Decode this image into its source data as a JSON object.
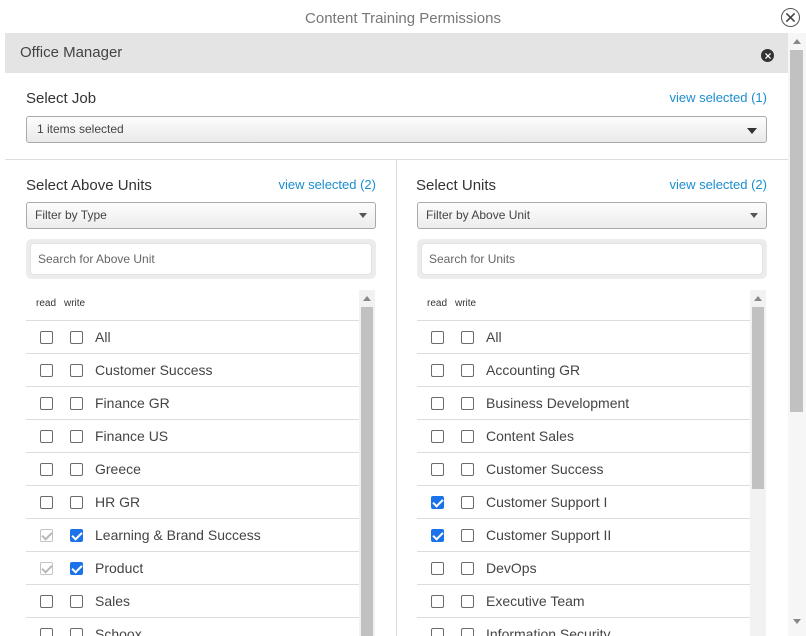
{
  "dialog": {
    "title": "Content Training Permissions"
  },
  "panel": {
    "title": "Office Manager"
  },
  "job": {
    "label": "Select Job",
    "view_selected": "view selected (1)",
    "select_value": "1 items selected"
  },
  "above_units": {
    "label": "Select Above Units",
    "view_selected": "view selected (2)",
    "filter_value": "Filter by Type",
    "search_placeholder": "Search for Above Unit",
    "col_read": "read",
    "col_write": "write",
    "items": [
      {
        "label": "All",
        "read": false,
        "write": false,
        "read_disabled": false
      },
      {
        "label": "Customer Success",
        "read": false,
        "write": false,
        "read_disabled": false
      },
      {
        "label": "Finance GR",
        "read": false,
        "write": false,
        "read_disabled": false
      },
      {
        "label": "Finance US",
        "read": false,
        "write": false,
        "read_disabled": false
      },
      {
        "label": "Greece",
        "read": false,
        "write": false,
        "read_disabled": false
      },
      {
        "label": "HR GR",
        "read": false,
        "write": false,
        "read_disabled": false
      },
      {
        "label": "Learning & Brand Success",
        "read": true,
        "write": true,
        "read_disabled": true
      },
      {
        "label": "Product",
        "read": true,
        "write": true,
        "read_disabled": true
      },
      {
        "label": "Sales",
        "read": false,
        "write": false,
        "read_disabled": false
      },
      {
        "label": "Schoox",
        "read": false,
        "write": false,
        "read_disabled": false
      }
    ]
  },
  "units": {
    "label": "Select Units",
    "view_selected": "view selected (2)",
    "filter_value": "Filter by Above Unit",
    "search_placeholder": "Search for Units",
    "col_read": "read",
    "col_write": "write",
    "items": [
      {
        "label": "All",
        "read": false,
        "write": false,
        "read_disabled": false
      },
      {
        "label": "Accounting GR",
        "read": false,
        "write": false,
        "read_disabled": false
      },
      {
        "label": "Business Development",
        "read": false,
        "write": false,
        "read_disabled": false
      },
      {
        "label": "Content Sales",
        "read": false,
        "write": false,
        "read_disabled": false
      },
      {
        "label": "Customer Success",
        "read": false,
        "write": false,
        "read_disabled": false
      },
      {
        "label": "Customer Support I",
        "read": true,
        "write": false,
        "read_disabled": false
      },
      {
        "label": "Customer Support II",
        "read": true,
        "write": false,
        "read_disabled": false
      },
      {
        "label": "DevOps",
        "read": false,
        "write": false,
        "read_disabled": false
      },
      {
        "label": "Executive Team",
        "read": false,
        "write": false,
        "read_disabled": false
      },
      {
        "label": "Information Security",
        "read": false,
        "write": false,
        "read_disabled": false
      }
    ]
  },
  "icons": {
    "dialog_close": "close-circle-outline-icon",
    "panel_close": "close-circle-filled-icon",
    "dropdown": "caret-down-icon"
  },
  "colors": {
    "link": "#1a8dd0",
    "checkbox_checked": "#1a73e8",
    "header_bg": "#e4e4e4"
  }
}
